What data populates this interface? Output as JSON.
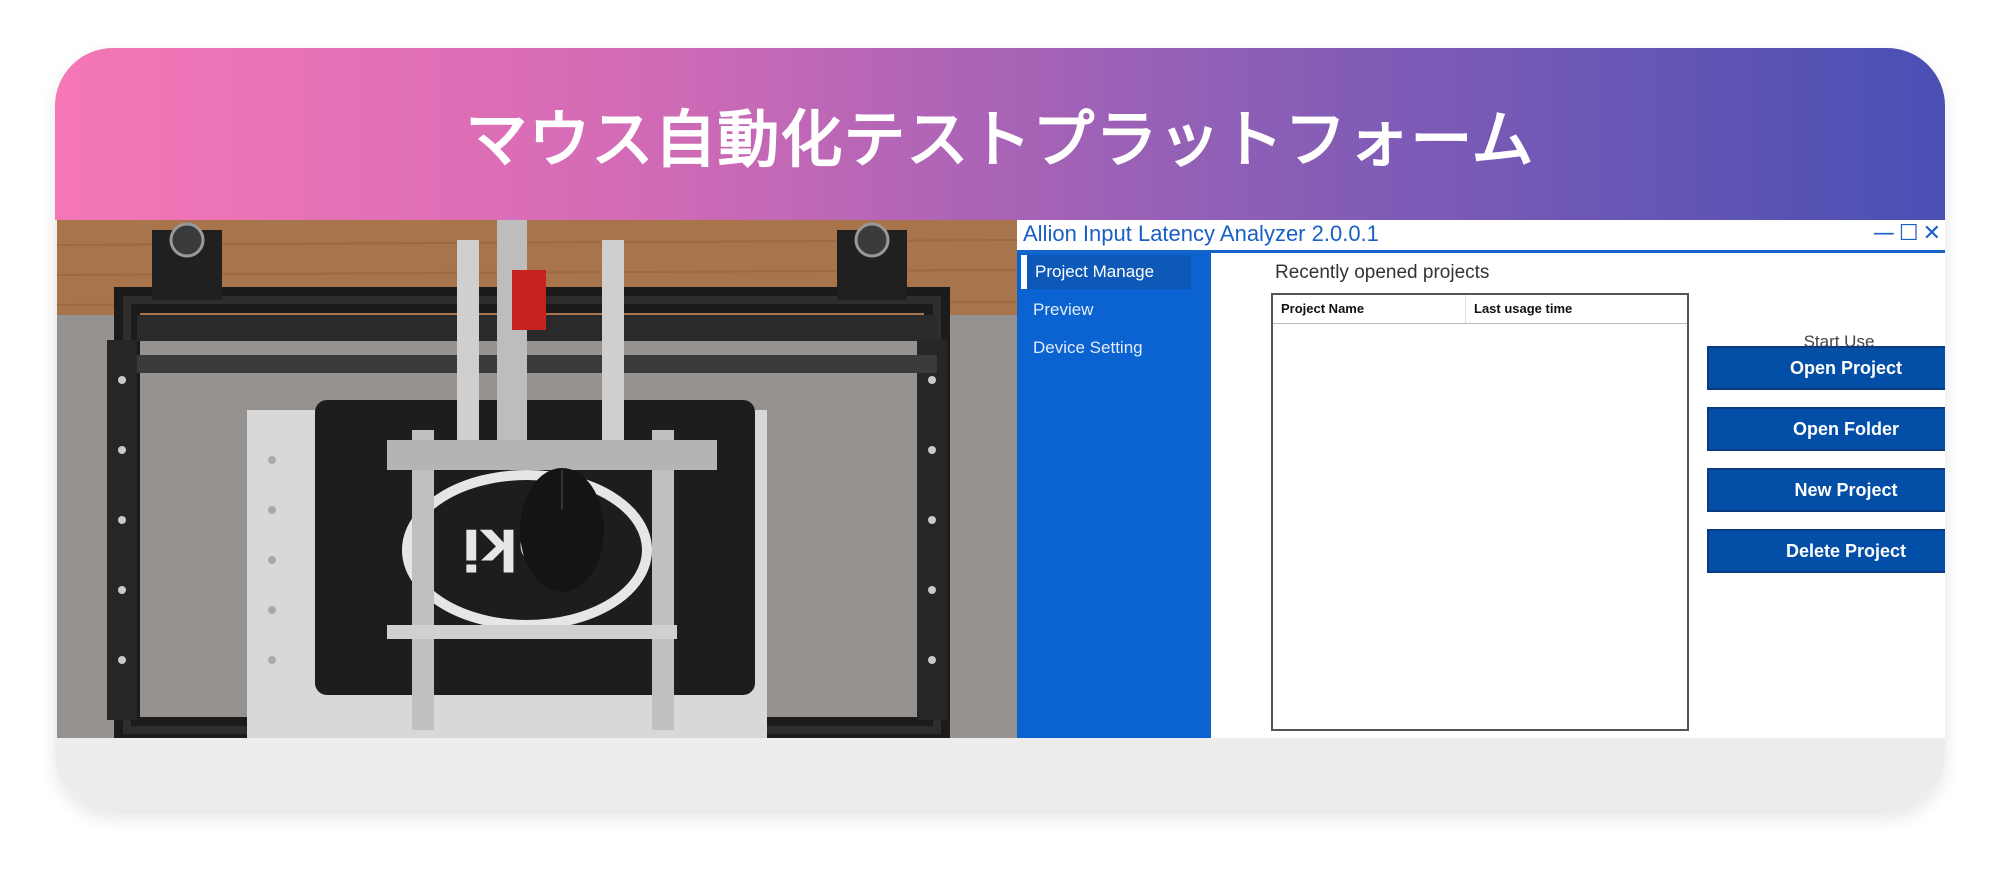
{
  "banner": {
    "title": "マウス自動化テストプラットフォーム"
  },
  "app": {
    "title": "Allion Input Latency Analyzer 2.0.0.1",
    "controls": {
      "minimize": "—",
      "maximize": "☐",
      "close": "✕"
    },
    "sidebar": {
      "items": [
        {
          "label": "Project Manage",
          "active": true
        },
        {
          "label": "Preview",
          "active": false
        },
        {
          "label": "Device Setting",
          "active": false
        }
      ]
    },
    "main": {
      "heading": "Recently opened projects",
      "table": {
        "columns": [
          "Project Name",
          "Last usage time"
        ],
        "rows": []
      }
    },
    "actions": {
      "start_use": "Start Use",
      "buttons": [
        "Open Project",
        "Open Folder",
        "New Project",
        "Delete Project"
      ]
    }
  },
  "photo": {
    "subject": "mouse-test-rig"
  },
  "colors": {
    "accent": "#0a63d1",
    "button": "#034ea6",
    "banner_start": "#f577b6",
    "banner_end": "#4a4fb4"
  }
}
